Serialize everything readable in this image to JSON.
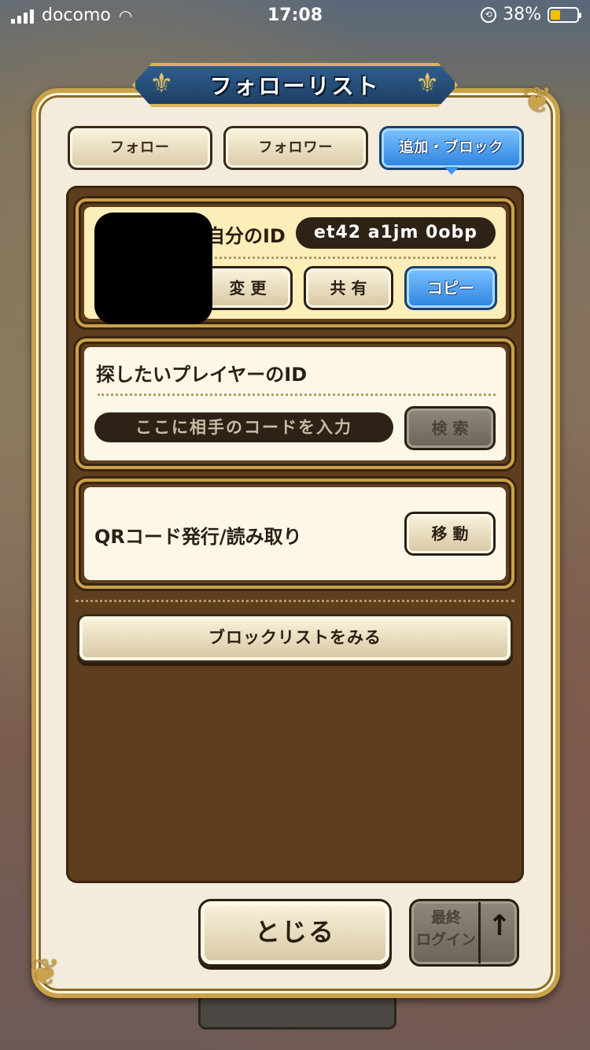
{
  "status_bar": {
    "carrier": "docomo",
    "time": "17:08",
    "battery_percent": "38%",
    "battery_level": 0.38
  },
  "dialog": {
    "title": "フォローリスト",
    "tabs": [
      {
        "label": "フォロー",
        "active": false
      },
      {
        "label": "フォロワー",
        "active": false
      },
      {
        "label": "追加・ブロック",
        "active": true
      }
    ],
    "my_id": {
      "label": "自分のID",
      "value": "et42 a1jm 0obp",
      "buttons": {
        "change": "変 更",
        "share": "共 有",
        "copy": "コピー"
      }
    },
    "search": {
      "heading": "探したいプレイヤーのID",
      "placeholder": "ここに相手のコードを入力",
      "button": "検 索"
    },
    "qr": {
      "label": "QRコード発行/読み取り",
      "button": "移 動"
    },
    "blocklist_button": "ブロックリストをみる",
    "close_button": "とじる",
    "sort_button": {
      "label_line1": "最終",
      "label_line2": "ログイン",
      "arrow": "↑"
    }
  },
  "colors": {
    "accent_blue": "#2c82e0",
    "frame_gold": "#c9a24a",
    "panel_brown": "#5e3f1d",
    "id_card_bg": "#fbeeb8"
  }
}
